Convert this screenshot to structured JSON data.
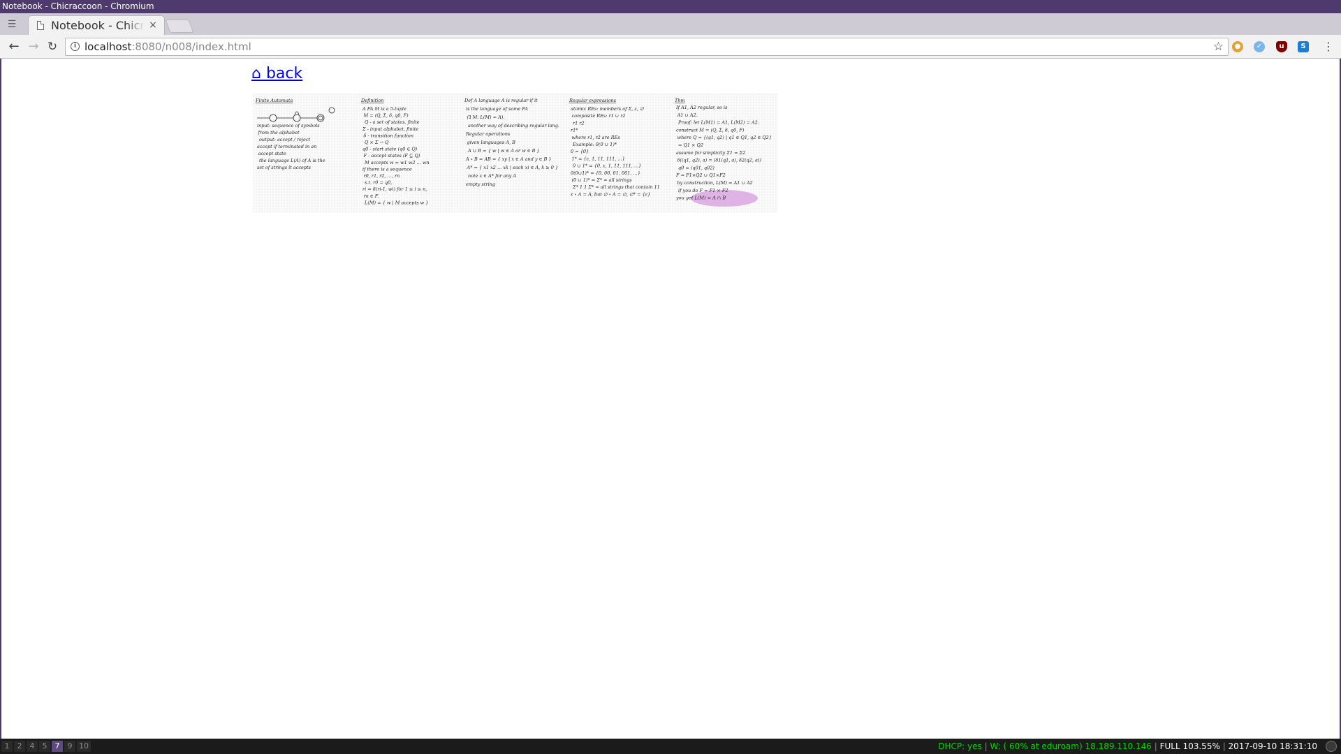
{
  "window": {
    "title": "Notebook - Chicraccoon - Chromium"
  },
  "tab": {
    "title": "Notebook - Chicraccoon",
    "close_glyph": "×"
  },
  "toolbar": {
    "url_host": "localhost",
    "url_rest": ":8080/n008/index.html",
    "back_glyph": "←",
    "forward_glyph": "→",
    "reload_glyph": "↻",
    "star_glyph": "☆",
    "menu_glyph": "⋮"
  },
  "page": {
    "back_link": "⌂ back",
    "notebook_page": {
      "col1_title": "Finite Automata",
      "col1_lines": [
        "input: sequence of symbols",
        "from the alphabet",
        "output: accept / reject",
        "accept if terminated in an",
        "accept state",
        "the language L(A) of A is the",
        "set of strings it accepts"
      ],
      "col2_title": "Definition",
      "col2_lines": [
        "A FA M is a 5-tuple",
        "M = (Q, Σ, δ, q0, F)",
        "Q - a set of states, finite",
        "Σ - input alphabet, finite",
        "δ - transition function",
        "Q × Σ → Q",
        "q0 - start state (q0 ∈ Q)",
        "F - accept states (F ⊆ Q)",
        "M accepts w = w1 w2 ... wn",
        "if there is a sequence",
        "r0, r1, r2, ..., rn",
        "s.t. r0 = q0,",
        "ri = δ(ri-1, wi) for 1 ≤ i ≤ n,",
        "rn ∈ F.",
        "L(M) = { w | M accepts w }"
      ],
      "col3_title": "Def A language A is regular if it",
      "col3_lines": [
        "is the language of some FA",
        "(∃ M: L(M) = A).",
        "another way of describing regular lang.",
        "Regular operations",
        "given languages A, B",
        "A ∪ B = { w | w ∈ A or w ∈ B }",
        "A ∘ B = AB = { xy | x ∈ A and y ∈ B }",
        "A* = { x1 x2 ... xk | each xi ∈ A, k ≥ 0 }",
        "note ε ∈ A* for any A",
        "empty string"
      ],
      "col4_title": "Regular expressions",
      "col4_lines": [
        "atomic REs: members of Σ, ε, ∅",
        "composite REs: r1 ∪ r2",
        "r1 r2",
        "r1*",
        "where r1, r2 are REs",
        "Example: 0(0 ∪ 1)*",
        "0 = {0}",
        "1* = {ε, 1, 11, 111, ...}",
        "0 ∪ 1* = {0, ε, 1, 11, 111, ...}",
        "0(0∪1)* = {0, 00, 01, 001, ...}",
        "(0 ∪ 1)* = Σ* = all strings",
        "Σ* 1 1 Σ* = all strings that contain 11",
        "ε ∘ A = A, but ∅ ∘ A = ∅, ∅* = {ε}"
      ],
      "col5_title": "Thm",
      "col5_lines": [
        "If A1, A2 regular, so is",
        "A1 ∪ A2.",
        "Proof: let L(M1) = A1, L(M2) = A2.",
        "construct M = (Q, Σ, δ, q0, F)",
        "where Q = {(q1, q2) | q1 ∈ Q1, q2 ∈ Q2}",
        "= Q1 × Q2",
        "assume for simplicity Σ1 = Σ2",
        "δ((q1, q2), a) = (δ1(q1, a), δ2(q2, a))",
        "q0 = (q01, q02)",
        "F = F1×Q2 ∪ Q1×F2",
        "by construction, L(M) = A1 ∪ A2",
        "if you do F = F1 × F2",
        "you get L(M) = A ∩ B"
      ]
    }
  },
  "statusbar": {
    "workspaces": [
      "1",
      "2",
      "4",
      "5",
      "7",
      "9",
      "10"
    ],
    "active_workspace": "7",
    "dhcp": "DHCP: yes",
    "wifi": "W: ( 60% at eduroam) 18.189.110.146",
    "battery": "FULL 103.55%",
    "time": "2017-09-10 18:31:10"
  },
  "colors": {
    "titlebar": "#4e3a6c",
    "link": "#0000ee",
    "status_ok": "#00d800",
    "highlight": "#d9a6e0"
  }
}
